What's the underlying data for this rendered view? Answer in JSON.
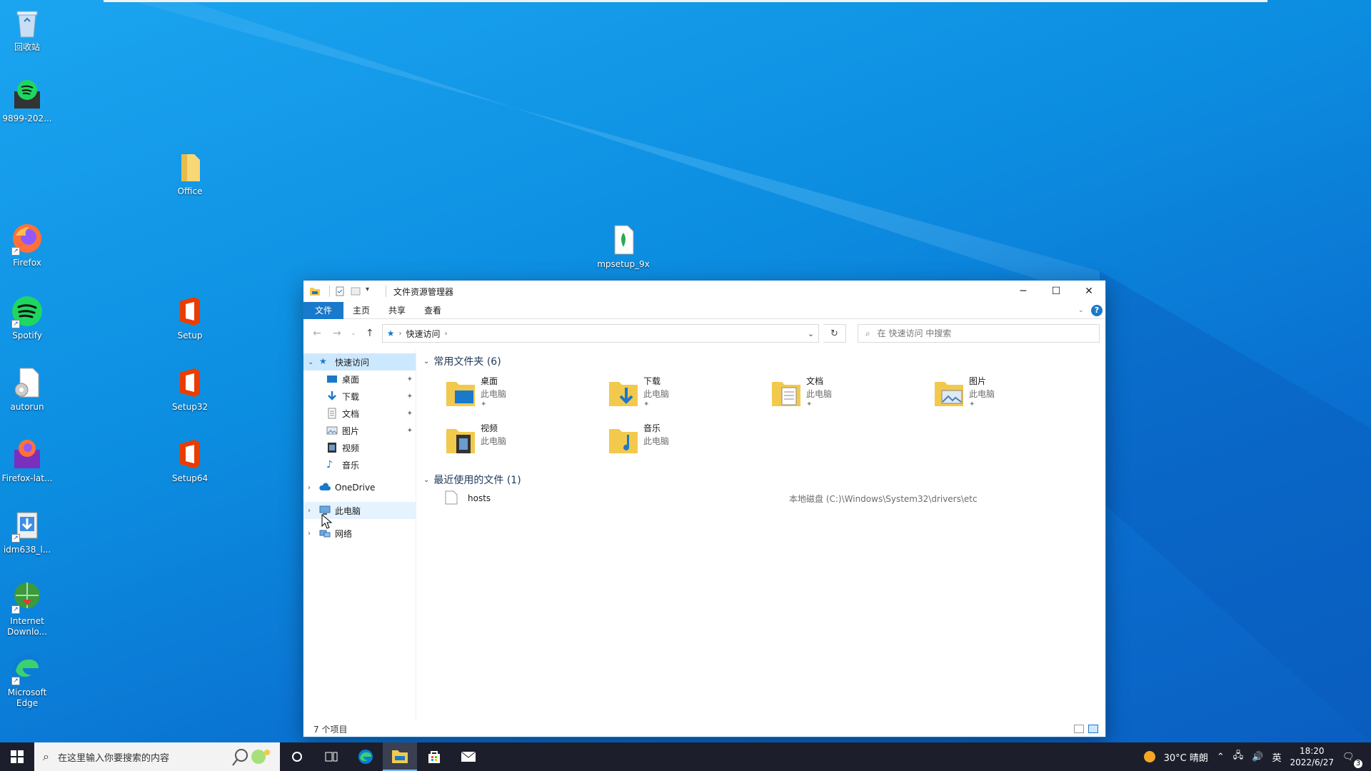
{
  "desktop": {
    "icons": [
      {
        "label": "回收站",
        "icon": "recycle-bin-icon"
      },
      {
        "label": "9899-202...",
        "icon": "spotify-installer-icon"
      },
      {
        "label": "Office",
        "icon": "folder-icon"
      },
      {
        "label": "Firefox",
        "icon": "firefox-icon"
      },
      {
        "label": "mpsetup_9x",
        "icon": "installer-file-icon"
      },
      {
        "label": "Spotify",
        "icon": "spotify-icon"
      },
      {
        "label": "Setup",
        "icon": "office-icon"
      },
      {
        "label": "autorun",
        "icon": "settings-file-icon"
      },
      {
        "label": "Setup32",
        "icon": "office-icon"
      },
      {
        "label": "Firefox-lat...",
        "icon": "firefox-installer-icon"
      },
      {
        "label": "Setup64",
        "icon": "office-icon"
      },
      {
        "label": "idm638_l...",
        "icon": "idm-installer-icon"
      },
      {
        "label": "Internet Downlo...",
        "icon": "idm-icon"
      },
      {
        "label": "Microsoft Edge",
        "icon": "edge-icon"
      }
    ]
  },
  "explorer": {
    "title": "文件资源管理器",
    "tabs": {
      "file": "文件",
      "home": "主页",
      "share": "共享",
      "view": "查看"
    },
    "address": {
      "crumb": "快速访问"
    },
    "search": {
      "placeholder": "在 快速访问 中搜索"
    },
    "nav": {
      "quick_access": "快速访问",
      "items": [
        {
          "label": "桌面",
          "icon": "desktop-folder-icon"
        },
        {
          "label": "下载",
          "icon": "download-icon"
        },
        {
          "label": "文档",
          "icon": "document-icon"
        },
        {
          "label": "图片",
          "icon": "picture-icon"
        },
        {
          "label": "视频",
          "icon": "video-icon"
        },
        {
          "label": "音乐",
          "icon": "music-icon"
        }
      ],
      "onedrive": "OneDrive",
      "this_pc": "此电脑",
      "network": "网络"
    },
    "frequent": {
      "header": "常用文件夹 (6)",
      "folders": [
        {
          "name": "桌面",
          "location": "此电脑",
          "pinned": true
        },
        {
          "name": "下载",
          "location": "此电脑",
          "pinned": true
        },
        {
          "name": "文档",
          "location": "此电脑",
          "pinned": true
        },
        {
          "name": "图片",
          "location": "此电脑",
          "pinned": true
        },
        {
          "name": "视频",
          "location": "此电脑",
          "pinned": false
        },
        {
          "name": "音乐",
          "location": "此电脑",
          "pinned": false
        }
      ]
    },
    "recent": {
      "header": "最近使用的文件 (1)",
      "files": [
        {
          "name": "hosts",
          "path": "本地磁盘 (C:)\\Windows\\System32\\drivers\\etc"
        }
      ]
    },
    "status": "7 个项目"
  },
  "taskbar": {
    "search_placeholder": "在这里输入你要搜索的内容",
    "weather": "30°C 晴朗",
    "ime": "英",
    "time": "18:20",
    "date": "2022/6/27",
    "notifications": "3"
  },
  "colors": {
    "accent": "#1979ca",
    "selection": "#cce8ff",
    "taskbar": "#1c1f2b"
  }
}
